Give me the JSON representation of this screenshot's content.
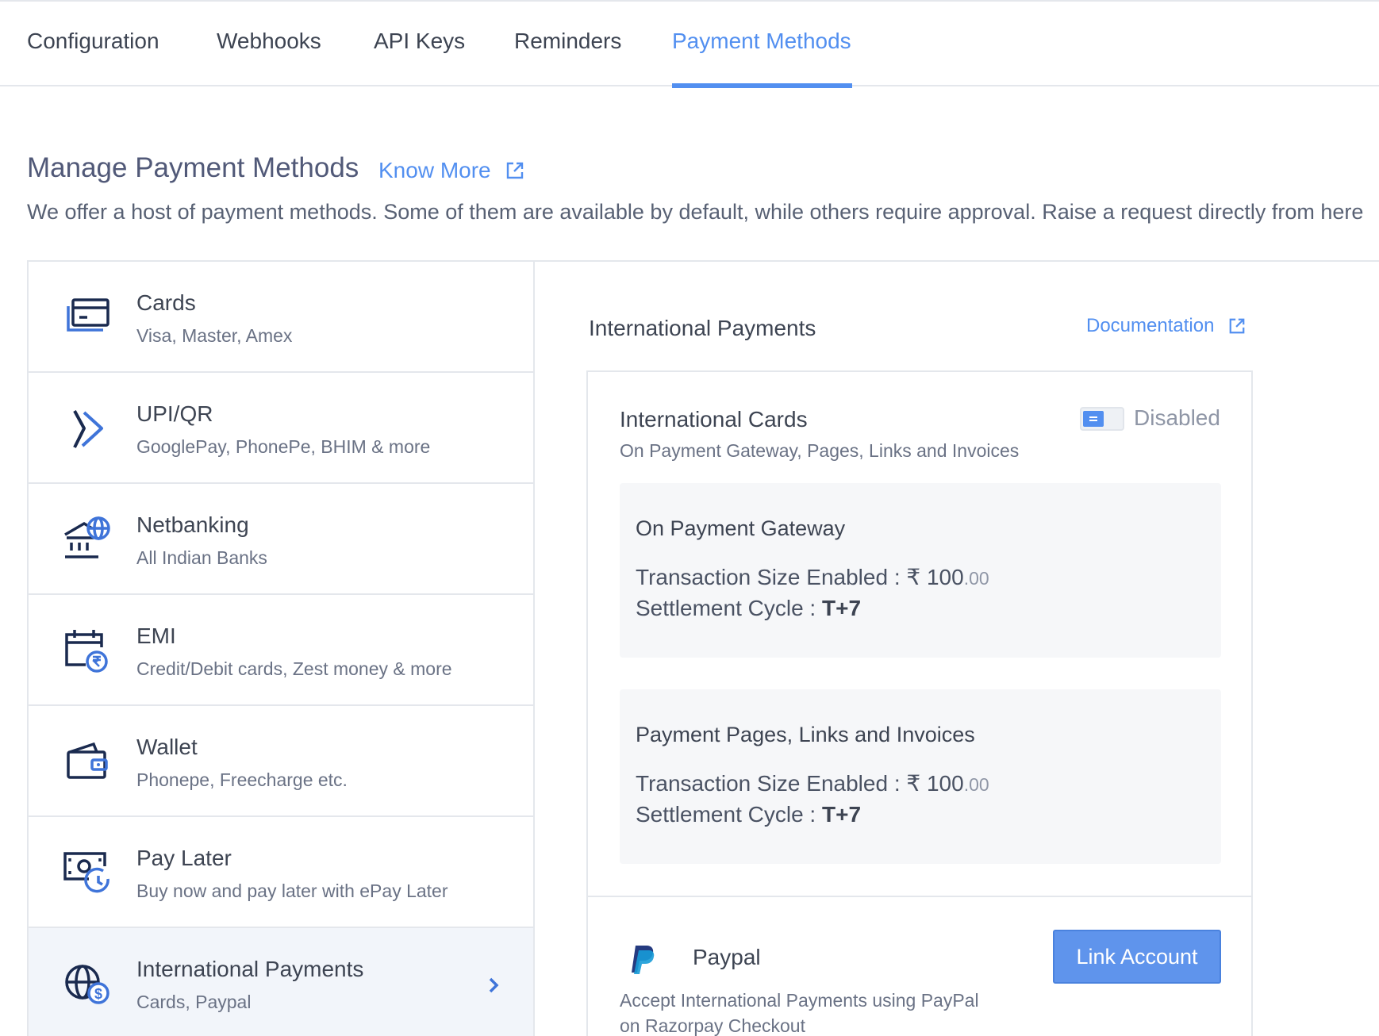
{
  "tabs": [
    {
      "label": "Configuration",
      "active": false
    },
    {
      "label": "Webhooks",
      "active": false
    },
    {
      "label": "API Keys",
      "active": false
    },
    {
      "label": "Reminders",
      "active": false
    },
    {
      "label": "Payment Methods",
      "active": true
    }
  ],
  "header": {
    "title": "Manage Payment Methods",
    "know_more": "Know More",
    "subtitle": "We offer a host of payment methods. Some of them are available by default, while others require approval. Raise a request directly from here"
  },
  "methods": [
    {
      "title": "Cards",
      "subtitle": "Visa, Master, Amex",
      "icon": "card-icon"
    },
    {
      "title": "UPI/QR",
      "subtitle": "GooglePay, PhonePe, BHIM & more",
      "icon": "upi-icon"
    },
    {
      "title": "Netbanking",
      "subtitle": "All Indian Banks",
      "icon": "bank-globe-icon"
    },
    {
      "title": "EMI",
      "subtitle": "Credit/Debit cards, Zest money & more",
      "icon": "calendar-rupee-icon"
    },
    {
      "title": "Wallet",
      "subtitle": "Phonepe, Freecharge etc.",
      "icon": "wallet-icon"
    },
    {
      "title": "Pay Later",
      "subtitle": "Buy now and pay later with ePay Later",
      "icon": "cash-clock-icon"
    },
    {
      "title": "International Payments",
      "subtitle": "Cards, Paypal",
      "icon": "globe-dollar-icon",
      "selected": true
    }
  ],
  "detail": {
    "title": "International Payments",
    "doc_link": "Documentation",
    "intl_cards": {
      "title": "International Cards",
      "subtitle": "On Payment Gateway, Pages, Links and Invoices",
      "toggle_state": "Disabled"
    },
    "panels": [
      {
        "title": "On Payment Gateway",
        "txn_label": "Transaction Size Enabled : ",
        "currency": "₹",
        "amount": "100",
        "decimals": ".00",
        "settlement_label": "Settlement Cycle : ",
        "settlement_value": "T+7"
      },
      {
        "title": "Payment Pages, Links and Invoices",
        "txn_label": "Transaction Size Enabled : ",
        "currency": "₹",
        "amount": "100",
        "decimals": ".00",
        "settlement_label": "Settlement Cycle : ",
        "settlement_value": "T+7"
      }
    ],
    "paypal": {
      "name": "Paypal",
      "desc_line1": "Accept International Payments using PayPal",
      "desc_line2": "on Razorpay Checkout",
      "button": "Link Account"
    }
  },
  "colors": {
    "accent": "#528ff0",
    "icon_dark": "#1a2a4f",
    "icon_blue": "#3f74d9",
    "border": "#e4e7ec",
    "selected_bg": "#f2f5fa"
  }
}
